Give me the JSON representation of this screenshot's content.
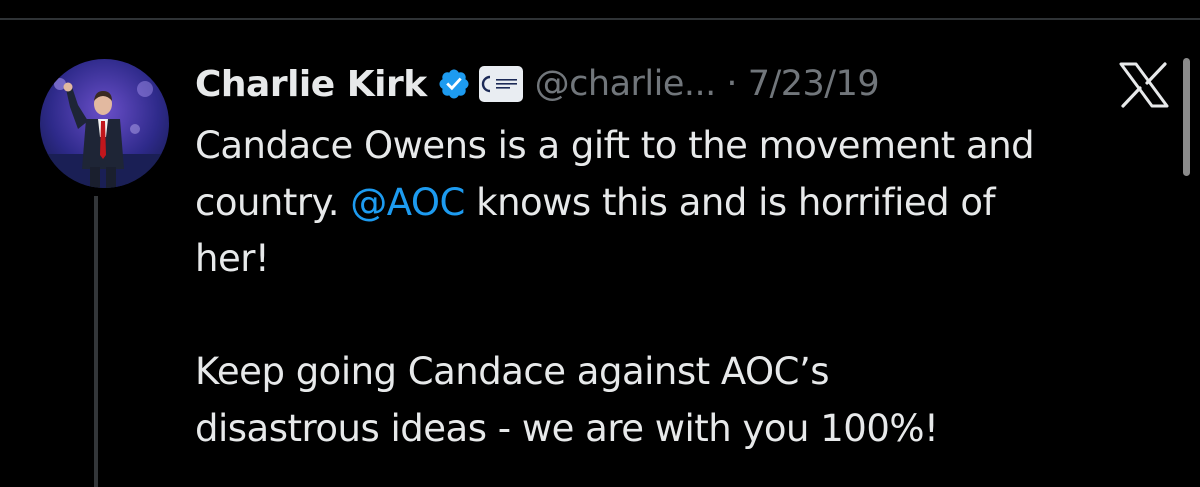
{
  "tweet": {
    "author_name": "Charlie Kirk",
    "handle": "@charlie...",
    "separator": "·",
    "date": "7/23/19",
    "org_badge": "TURNING POINT USA",
    "text_lines": {
      "l1": "Candace Owens is a gift to the movement and",
      "l2_pre": "country. ",
      "l2_mention": "@AOC",
      "l2_post": " knows this and is horrified of",
      "l3": "her!",
      "l4": "Keep going Candace against AOC’s",
      "l5": "disastrous ideas  - we are with you 100%!"
    }
  },
  "icons": {
    "verified": "verified-badge-icon",
    "org": "turning-point-usa-logo-icon",
    "platform": "x-logo-icon"
  },
  "colors": {
    "background": "#000000",
    "text": "#e7e9ea",
    "secondary_text": "#71767b",
    "mention": "#1d9bf0",
    "verified": "#1d9bf0",
    "divider": "#2f3336"
  }
}
